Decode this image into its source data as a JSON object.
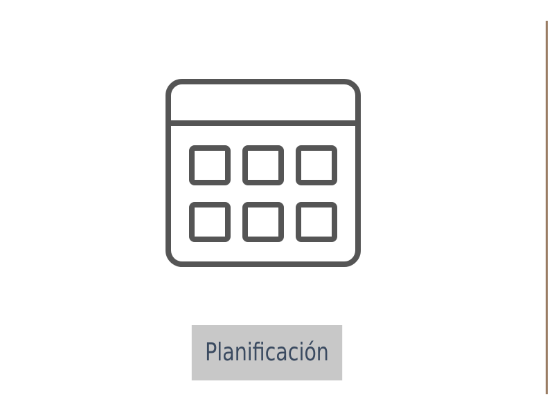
{
  "tile": {
    "label": "Planificación",
    "icon": "calendar-grid-icon",
    "label_bg_color": "#c8c8c8",
    "label_text_color": "#3a4a60",
    "icon_color": "#555555"
  },
  "divider": {
    "color": "#9a7c63"
  }
}
